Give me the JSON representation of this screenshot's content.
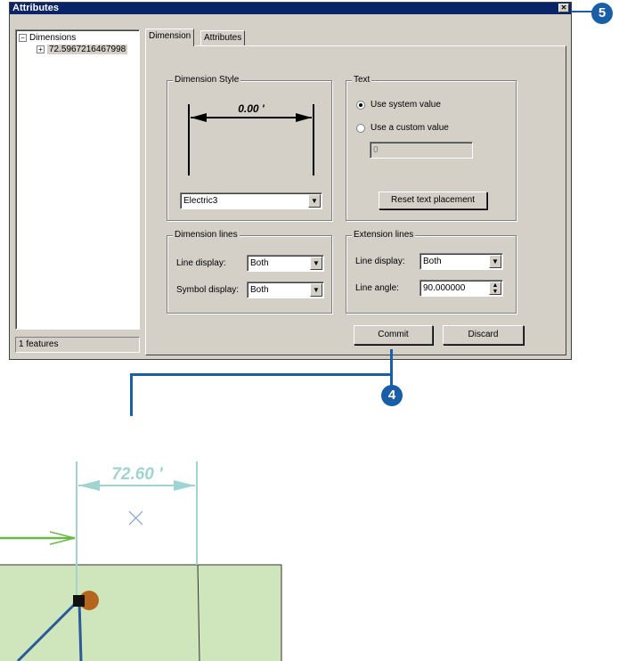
{
  "window": {
    "title": "Attributes"
  },
  "tree": {
    "root_label": "Dimensions",
    "child_label": "72.5967216467998",
    "root_toggle": "−",
    "child_toggle": "+"
  },
  "status": {
    "text": "1 features"
  },
  "tabs": [
    {
      "label": "Dimension"
    },
    {
      "label": "Attributes"
    }
  ],
  "dimension_style": {
    "group_label": "Dimension Style",
    "preview_value": "0.00 '",
    "style_value": "Electric3"
  },
  "text_group": {
    "group_label": "Text",
    "option_system": "Use system value",
    "option_custom": "Use a custom value",
    "custom_value": "0",
    "selected": "system",
    "reset_label": "Reset text placement"
  },
  "dimension_lines": {
    "group_label": "Dimension lines",
    "line_display_label": "Line display:",
    "line_display_value": "Both",
    "symbol_display_label": "Symbol display:",
    "symbol_display_value": "Both"
  },
  "extension_lines": {
    "group_label": "Extension lines",
    "line_display_label": "Line display:",
    "line_display_value": "Both",
    "line_angle_label": "Line angle:",
    "line_angle_value": "90.000000"
  },
  "actions": {
    "commit_label": "Commit",
    "discard_label": "Discard"
  },
  "callouts": {
    "step_close": "5",
    "step_commit": "4"
  },
  "map": {
    "dimension_text": "72.60 '",
    "colors": {
      "dimension": "#9fd4d0",
      "parcel_fill": "#cfe6bd",
      "arrow_green": "#6ab84a",
      "vertex_orange": "#b5651d",
      "line_blue": "#2a5a9a"
    }
  },
  "colors": {
    "callout": "#1a5ea8",
    "titlebar": "#0a246a",
    "dialog": "#d4d0c8"
  }
}
